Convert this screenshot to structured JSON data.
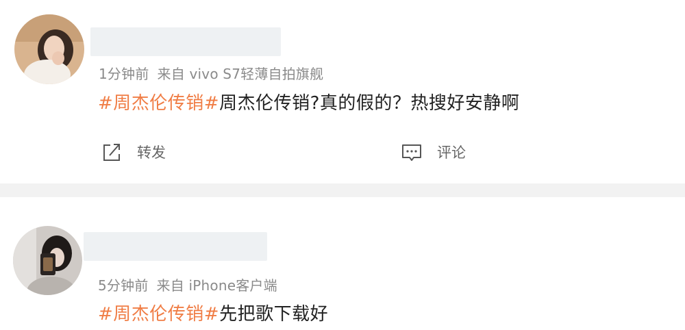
{
  "posts": [
    {
      "time": "1分钟前",
      "source": "来自 vivo S7轻薄自拍旗舰",
      "hashtag": "#周杰伦传销#",
      "text": "周杰伦传销?真的假的？热搜好安静啊",
      "actions": {
        "repost_label": "转发",
        "repost_icon": "share-icon",
        "comment_label": "评论",
        "comment_icon": "comment-icon"
      }
    },
    {
      "time": "5分钟前",
      "source": "来自 iPhone客户端",
      "hashtag": "#周杰伦传销#",
      "text": "先把歌下载好"
    }
  ],
  "colors": {
    "hashtag": "#f07d45",
    "meta": "#8a8a8a",
    "separator": "#f2f2f2"
  }
}
